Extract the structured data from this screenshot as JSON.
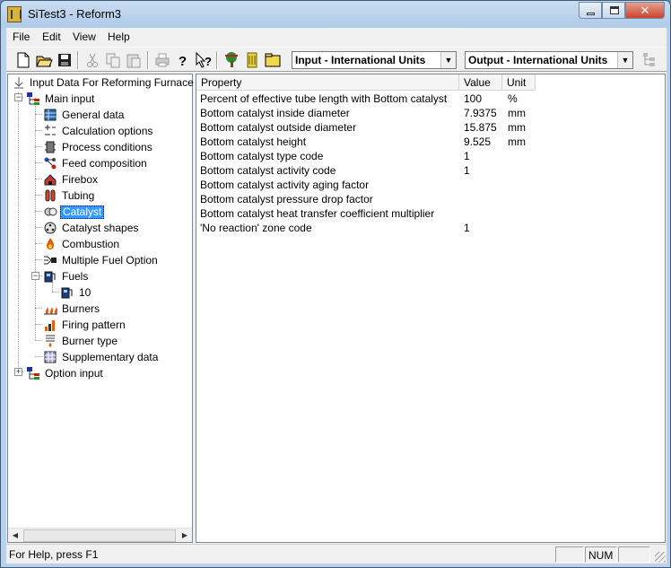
{
  "window": {
    "title": "SiTest3 - Reform3"
  },
  "menu": [
    {
      "label": "File"
    },
    {
      "label": "Edit"
    },
    {
      "label": "View"
    },
    {
      "label": "Help"
    }
  ],
  "toolbar": {
    "buttons": [
      "new-file-icon",
      "open-folder-icon",
      "save-disk-icon",
      "cut-scissors-icon",
      "copy-icon",
      "paste-icon",
      "print-icon",
      "help-question-icon",
      "context-help-icon",
      "tree-icon",
      "catalyst-icon",
      "folder-icon",
      "layout-icon"
    ],
    "input_units": "Input - International Units",
    "output_units": "Output - International Units"
  },
  "tree": {
    "root": "Input Data For Reforming Furnace",
    "main_input": "Main input",
    "items": [
      {
        "label": "General data",
        "icon": "table-icon"
      },
      {
        "label": "Calculation options",
        "icon": "calc-options-icon"
      },
      {
        "label": "Process conditions",
        "icon": "process-icon"
      },
      {
        "label": "Feed composition",
        "icon": "molecule-icon"
      },
      {
        "label": "Firebox",
        "icon": "house-icon"
      },
      {
        "label": "Tubing",
        "icon": "tubes-icon"
      },
      {
        "label": "Catalyst",
        "icon": "catalyst-icon"
      },
      {
        "label": "Catalyst shapes",
        "icon": "shape-icon"
      },
      {
        "label": "Combustion",
        "icon": "flame-icon"
      },
      {
        "label": "Multiple Fuel Option",
        "icon": "fuel-merge-icon"
      },
      {
        "label": "Fuels",
        "icon": "fuel-pump-icon"
      },
      {
        "label": "10",
        "icon": "fuel-pump-icon"
      },
      {
        "label": "Burners",
        "icon": "burners-icon"
      },
      {
        "label": "Firing pattern",
        "icon": "bars-icon"
      },
      {
        "label": "Burner type",
        "icon": "burner-type-icon"
      },
      {
        "label": "Supplementary data",
        "icon": "supplement-icon"
      }
    ],
    "option_input": "Option input",
    "selected": "Catalyst"
  },
  "grid": {
    "headers": {
      "property": "Property",
      "value": "Value",
      "unit": "Unit"
    },
    "rows": [
      {
        "property": "Percent of effective tube length with Bottom catalyst",
        "value": "100",
        "unit": "%"
      },
      {
        "property": "Bottom catalyst inside diameter",
        "value": "7.9375",
        "unit": "mm"
      },
      {
        "property": "Bottom catalyst outside diameter",
        "value": "15.875",
        "unit": "mm"
      },
      {
        "property": "Bottom catalyst height",
        "value": "9.525",
        "unit": "mm"
      },
      {
        "property": "Bottom catalyst type code",
        "value": "1",
        "unit": ""
      },
      {
        "property": "Bottom catalyst activity code",
        "value": "1",
        "unit": ""
      },
      {
        "property": "Bottom catalyst activity aging factor",
        "value": "",
        "unit": ""
      },
      {
        "property": "Bottom catalyst pressure drop factor",
        "value": "",
        "unit": ""
      },
      {
        "property": "Bottom catalyst heat transfer coefficient multiplier",
        "value": "",
        "unit": ""
      },
      {
        "property": "'No reaction' zone code",
        "value": "1",
        "unit": ""
      }
    ]
  },
  "status": {
    "help": "For Help, press F1",
    "num": "NUM"
  }
}
